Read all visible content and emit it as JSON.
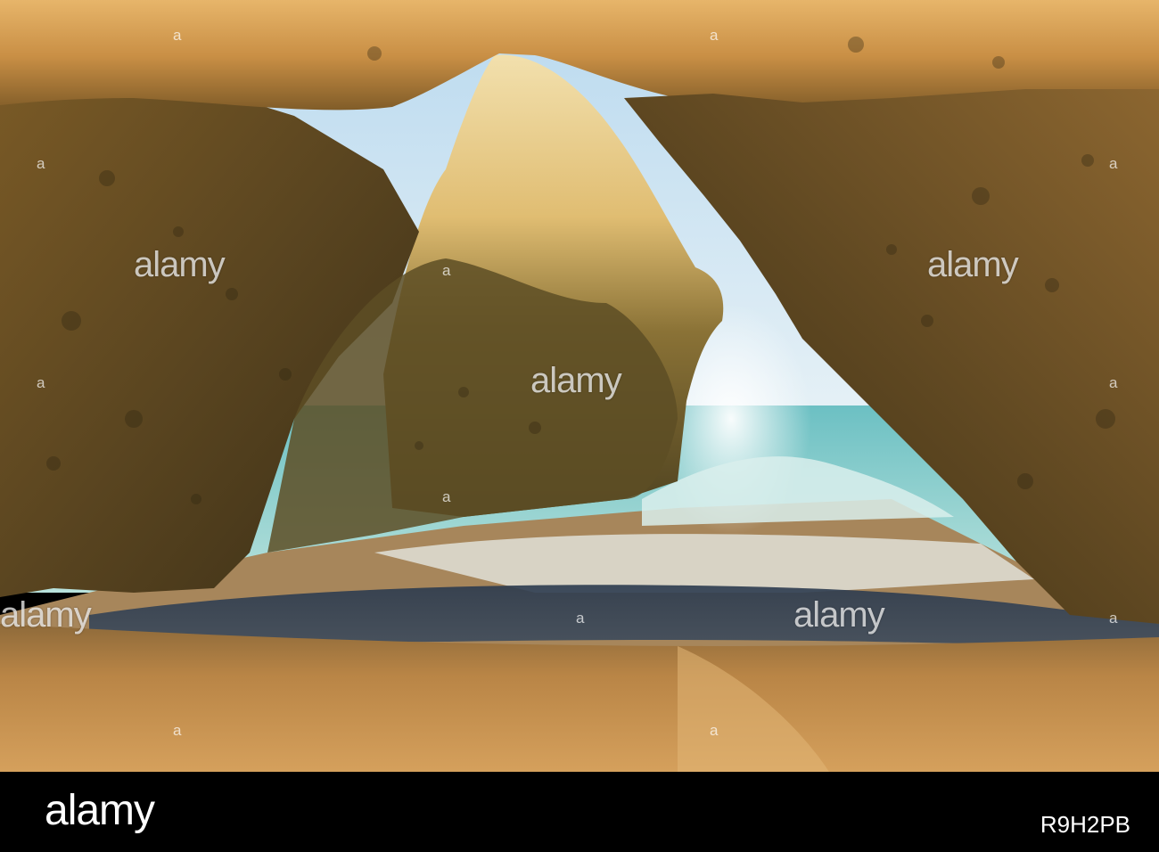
{
  "watermark": {
    "text": "alamy",
    "short": "a"
  },
  "footer": {
    "logo": "alamy",
    "image_id": "R9H2PB"
  },
  "colors": {
    "sand": "#c9924f",
    "rock_dark": "#5b4a24",
    "rock_light": "#e8cf8a",
    "sea": "#8fd0cc",
    "sky": "#cfe6f2",
    "footer_bg": "#000000"
  }
}
